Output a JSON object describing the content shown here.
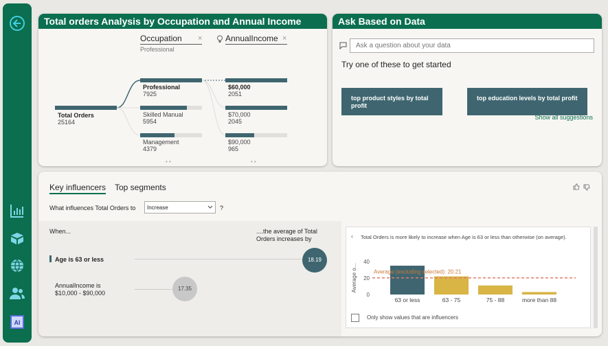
{
  "decomposition": {
    "title": "Total orders Analysis by Occupation and Annual Income",
    "occupation_header": "Occupation",
    "occupation_filter": "Professional",
    "income_header": "AnnualIncome",
    "root": {
      "label": "Total Orders",
      "value": "25164"
    },
    "occupation_items": [
      {
        "label": "Professional",
        "value": "7925",
        "fill": 1.0
      },
      {
        "label": "Skilled Manual",
        "value": "5954",
        "fill": 0.75
      },
      {
        "label": "Management",
        "value": "4379",
        "fill": 0.55
      }
    ],
    "income_items": [
      {
        "label": "$60,000",
        "value": "2051",
        "fill": 1.0
      },
      {
        "label": "$70,000",
        "value": "2045",
        "fill": 1.0
      },
      {
        "label": "$90,000",
        "value": "965",
        "fill": 0.47
      }
    ]
  },
  "qa": {
    "title": "Ask Based on Data",
    "placeholder": "Ask a question about your data",
    "prompt": "Try one of these to get started",
    "suggestions": [
      "top product styles by total profit",
      "top education levels by total profit"
    ],
    "show_all": "Show all suggestions"
  },
  "key_influencers": {
    "tabs": [
      "Key influencers",
      "Top segments"
    ],
    "question_label": "What influences Total Orders to",
    "dropdown_value": "Increase",
    "help": "?",
    "when_label": "When...",
    "average_label_1": "....the average of Total",
    "average_label_2": "Orders increases by",
    "influencers": [
      {
        "label": "Age is 63 or less",
        "value": "18.19"
      },
      {
        "label_line1": "AnnualIncome is",
        "label_line2": "$10,000 - $90,000",
        "value": "17.35"
      }
    ],
    "detail": {
      "back": "‹",
      "description": "Total Orders is more likely to increase when Age is 63 or less than otherwise (on average).",
      "checkbox_label": "Only show values that are influencers"
    }
  },
  "chart_data": {
    "type": "bar",
    "categories": [
      "63 or less",
      "63 - 75",
      "75 - 88",
      "more than 88"
    ],
    "values": [
      35,
      22,
      11,
      3
    ],
    "highlight_index": 0,
    "ylabel": "Average o...",
    "yticks": [
      0,
      20,
      40
    ],
    "ylim": [
      0,
      40
    ],
    "reference_line": {
      "value": 20.21,
      "label": "Average (excluding selected): 20.21"
    },
    "colors": {
      "highlight": "#3f6670",
      "bars": "#d8b545",
      "reference": "#e07b6a"
    }
  }
}
